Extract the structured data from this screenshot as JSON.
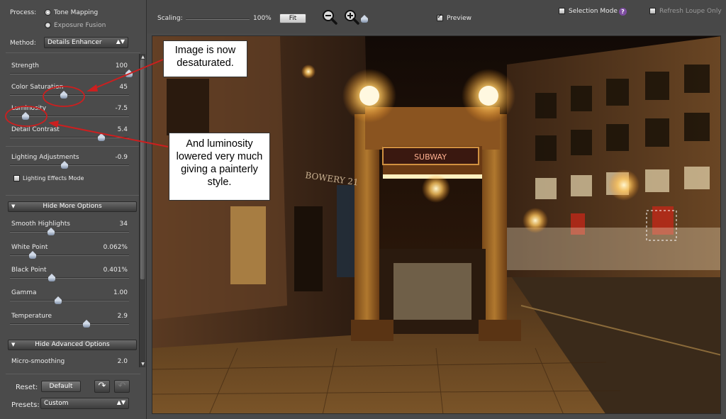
{
  "process": {
    "label": "Process:",
    "options": [
      "Tone Mapping",
      "Exposure Fusion"
    ],
    "selected": "Tone Mapping"
  },
  "method": {
    "label": "Method:",
    "selected": "Details Enhancer"
  },
  "sliders": [
    {
      "label": "Strength",
      "value": "100",
      "level": 1.0
    },
    {
      "label": "Color Saturation",
      "value": "45",
      "level": 0.45
    },
    {
      "label": "Luminosity",
      "value": "-7.5",
      "level": 0.12
    },
    {
      "label": "Detail Contrast",
      "value": "5.4",
      "level": 0.76
    },
    {
      "label": "Lighting Adjustments",
      "value": "-0.9",
      "level": 0.46
    }
  ],
  "lighting_effects_mode": {
    "label": "Lighting Effects Mode",
    "checked": false
  },
  "more_options": {
    "header": "Hide More Options",
    "sliders": [
      {
        "label": "Smooth Highlights",
        "value": "34",
        "level": 0.34
      },
      {
        "label": "White Point",
        "value": "0.062%",
        "level": 0.18
      },
      {
        "label": "Black Point",
        "value": "0.401%",
        "level": 0.34
      },
      {
        "label": "Gamma",
        "value": "1.00",
        "level": 0.4
      },
      {
        "label": "Temperature",
        "value": "2.9",
        "level": 0.64
      }
    ]
  },
  "advanced_options": {
    "header": "Hide Advanced Options",
    "sliders": [
      {
        "label": "Micro-smoothing",
        "value": "2.0",
        "level": 0.1
      }
    ]
  },
  "reset": {
    "label": "Reset:",
    "button": "Default"
  },
  "presets": {
    "label": "Presets:",
    "selected": "Custom"
  },
  "toolbar": {
    "scaling_label": "Scaling:",
    "scaling_value": "100%",
    "scaling_level": 0.5,
    "fit_button": "Fit",
    "preview_label": "Preview",
    "preview_checked": true,
    "selection_mode_label": "Selection Mode",
    "selection_mode_checked": false,
    "refresh_loupe_label": "Refresh Loupe Only",
    "refresh_loupe_checked": false
  },
  "image": {
    "sign_text": "SUBWAY",
    "building_sign": "BOWERY 21"
  },
  "annotations": [
    {
      "text": "Image is now desaturated."
    },
    {
      "text": "And luminosity lowered very much giving a painterly style."
    }
  ],
  "colors": {
    "panel_bg": "#4b4b4b",
    "accent_annotation": "#cc1f1f",
    "slider_thumb": "#c6d2e4"
  }
}
